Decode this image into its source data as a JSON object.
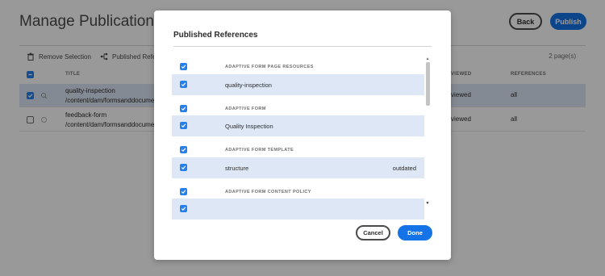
{
  "page": {
    "title": "Manage Publication",
    "back_label": "Back",
    "publish_label": "Publish",
    "toolbar": {
      "remove_selection": "Remove Selection",
      "published_references": "Published Refere"
    },
    "page_count": "2 page(s)",
    "columns": {
      "title": "TITLE",
      "status": "VIEWED",
      "references": "REFERENCES"
    },
    "rows": [
      {
        "name": "quality-inspection",
        "path": "/content/dam/formsanddocumen",
        "status": "viewed",
        "references": "all",
        "selected": true
      },
      {
        "name": "feedback-form",
        "path": "/content/dam/formsanddocumen",
        "status": "viewed",
        "references": "all",
        "selected": false
      }
    ]
  },
  "dialog": {
    "title": "Published References",
    "items": [
      {
        "type": "group",
        "label": "ADAPTIVE FORM PAGE RESOURCES",
        "checked": true
      },
      {
        "type": "item",
        "label": "quality-inspection",
        "checked": true,
        "extra": ""
      },
      {
        "type": "group",
        "label": "ADAPTIVE FORM",
        "checked": true
      },
      {
        "type": "item",
        "label": "Quality Inspection",
        "checked": true,
        "extra": ""
      },
      {
        "type": "group",
        "label": "ADAPTIVE FORM TEMPLATE",
        "checked": true
      },
      {
        "type": "item",
        "label": "structure",
        "checked": true,
        "extra": "outdated"
      },
      {
        "type": "group",
        "label": "ADAPTIVE FORM CONTENT POLICY",
        "checked": true
      },
      {
        "type": "item",
        "label": "",
        "checked": true,
        "extra": ""
      }
    ],
    "cancel_label": "Cancel",
    "done_label": "Done"
  },
  "colors": {
    "accent": "#1473e6",
    "checkbox": "#2680eb",
    "row_selected": "#dde7f5"
  },
  "icons": {
    "remove": "trash-icon",
    "references": "references-icon",
    "checkbox": "checkmark-icon",
    "row_asset": "asset-icon"
  }
}
